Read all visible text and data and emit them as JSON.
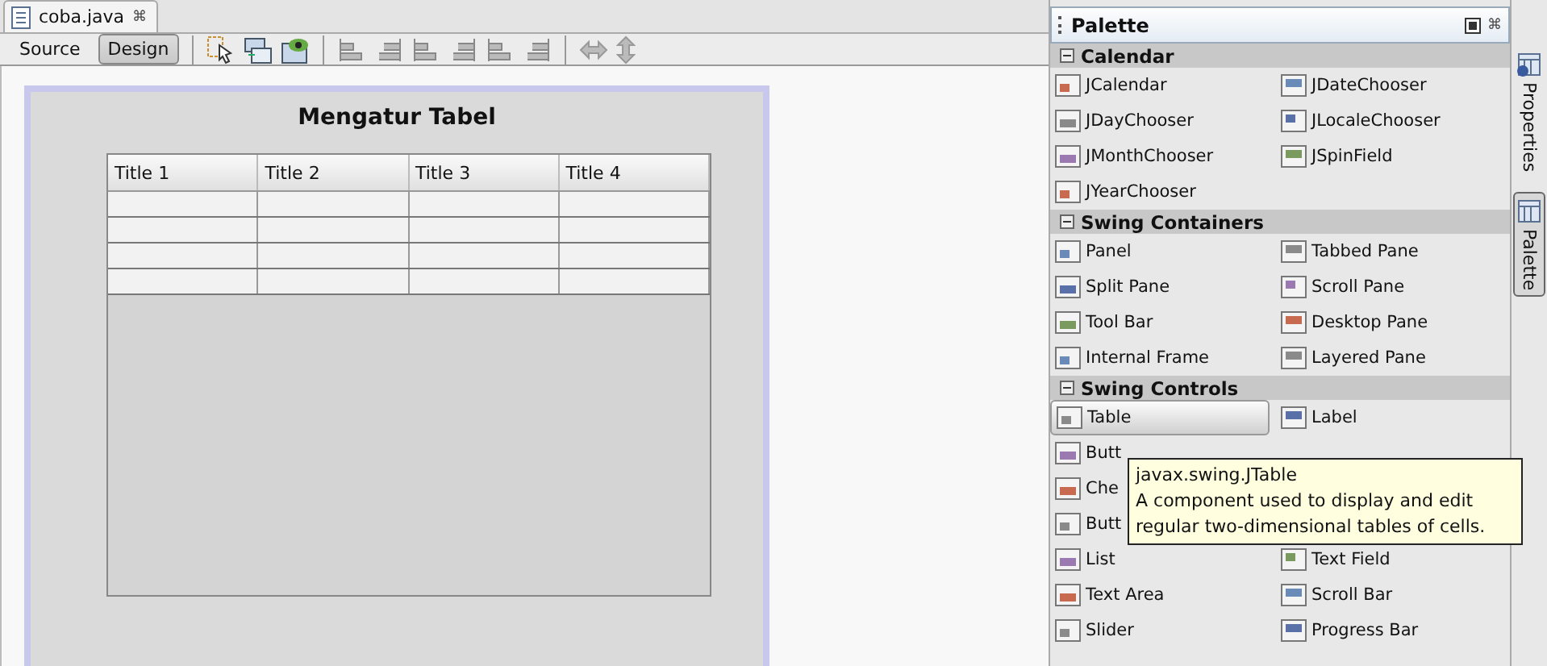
{
  "editor_tab": {
    "label": "coba.java",
    "close": "⌘"
  },
  "view_buttons": [
    {
      "label": "Source",
      "selected": false
    },
    {
      "label": "Design",
      "selected": true
    }
  ],
  "form": {
    "title": "Mengatur Tabel",
    "table": {
      "columns": [
        "Title 1",
        "Title 2",
        "Title 3",
        "Title 4"
      ]
    }
  },
  "palette": {
    "title": "Palette",
    "categories": [
      {
        "name": "Calendar",
        "expanded": true,
        "items": [
          {
            "label": "JCalendar",
            "selected": false
          },
          {
            "label": "JDateChooser",
            "selected": false
          },
          {
            "label": "JDayChooser",
            "selected": false
          },
          {
            "label": "JLocaleChooser",
            "selected": false
          },
          {
            "label": "JMonthChooser",
            "selected": false
          },
          {
            "label": "JSpinField",
            "selected": false
          },
          {
            "label": "JYearChooser",
            "selected": false
          }
        ]
      },
      {
        "name": "Swing Containers",
        "expanded": true,
        "items": [
          {
            "label": "Panel",
            "selected": false
          },
          {
            "label": "Tabbed Pane",
            "selected": false
          },
          {
            "label": "Split Pane",
            "selected": false
          },
          {
            "label": "Scroll Pane",
            "selected": false
          },
          {
            "label": "Tool Bar",
            "selected": false
          },
          {
            "label": "Desktop Pane",
            "selected": false
          },
          {
            "label": "Internal Frame",
            "selected": false
          },
          {
            "label": "Layered Pane",
            "selected": false
          }
        ]
      },
      {
        "name": "Swing Controls",
        "expanded": true,
        "items": [
          {
            "label": "Table",
            "selected": true
          },
          {
            "label": "Label",
            "selected": false
          },
          {
            "label": "Butt",
            "selected": false
          },
          {
            "kind": "covered"
          },
          {
            "label": "Che",
            "selected": false
          },
          {
            "kind": "covered"
          },
          {
            "label": "Butt",
            "selected": false
          },
          {
            "kind": "covered"
          },
          {
            "label": "List",
            "selected": false
          },
          {
            "label": "Text Field",
            "selected": false
          },
          {
            "label": "Text Area",
            "selected": false
          },
          {
            "label": "Scroll Bar",
            "selected": false
          },
          {
            "label": "Slider",
            "selected": false
          },
          {
            "label": "Progress Bar",
            "selected": false
          }
        ]
      }
    ],
    "tooltip": {
      "title": "javax.swing.JTable",
      "text": "A component used to display and edit regular two-dimensional tables of cells."
    }
  },
  "side_tabs": [
    {
      "label": "Properties",
      "selected": false
    },
    {
      "label": "Palette",
      "selected": true
    }
  ]
}
